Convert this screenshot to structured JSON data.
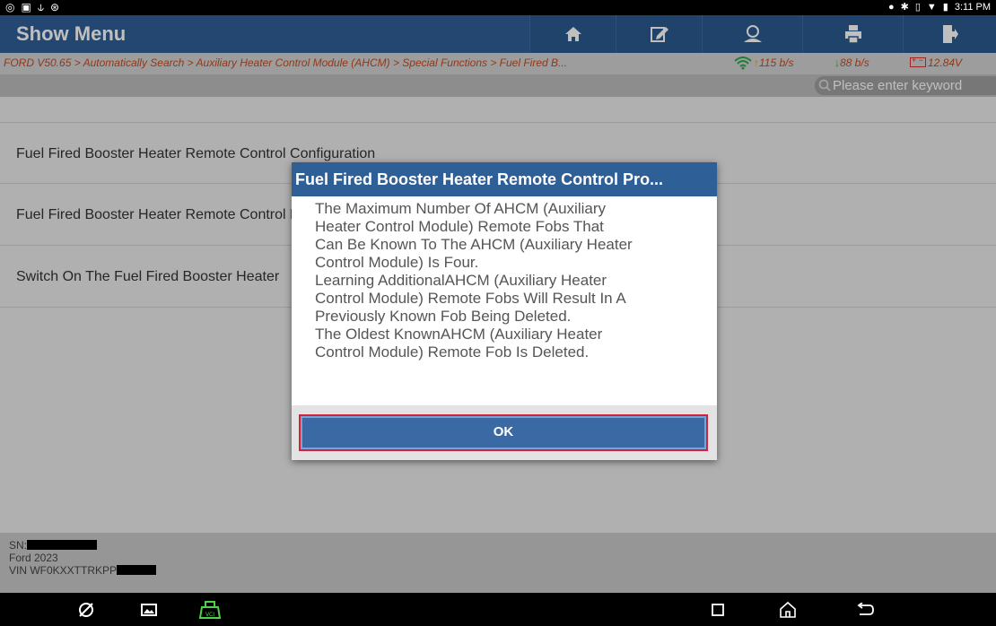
{
  "status_bar": {
    "time": "3:11 PM",
    "left_icons": [
      "chat-icon",
      "image-icon",
      "usb-icon",
      "accessibility-icon"
    ],
    "right_icons": [
      "location-icon",
      "bluetooth-icon",
      "vibrate-icon",
      "wifi-icon",
      "battery-icon"
    ]
  },
  "toolbar": {
    "title": "Show Menu",
    "buttons": [
      "home-icon",
      "edit-icon",
      "user-icon",
      "print-icon",
      "exit-icon"
    ]
  },
  "breadcrumb": {
    "path": "FORD V50.65 > Automatically Search > Auxiliary Heater Control Module (AHCM) > Special Functions > Fuel Fired B...",
    "upload_speed": "115 b/s",
    "download_speed": "88 b/s",
    "battery_voltage": "12.84V"
  },
  "search": {
    "placeholder": "Please enter keyword"
  },
  "menu_items": [
    "Fuel Fired Booster Heater Remote Control Configuration",
    "Fuel Fired Booster Heater Remote Control Programming",
    "Switch On The Fuel Fired Booster Heater"
  ],
  "footer": {
    "sn_label": "SN:",
    "vehicle": "Ford  2023",
    "vin_label": "VIN WF0KXXTTRKPP"
  },
  "dialog": {
    "title": "Fuel Fired Booster Heater Remote Control Pro...",
    "lines": [
      "The Maximum Number Of AHCM (Auxiliary",
      "Heater Control Module) Remote Fobs That",
      "Can Be Known To The AHCM (Auxiliary Heater",
      "Control Module) Is Four.",
      "Learning AdditionalAHCM (Auxiliary Heater",
      "Control Module) Remote Fobs Will Result In A",
      "Previously Known Fob Being Deleted.",
      "The Oldest KnownAHCM (Auxiliary Heater",
      "Control Module) Remote Fob Is Deleted."
    ],
    "ok_label": "OK"
  },
  "colors": {
    "toolbar": "#2f5f97",
    "breadcrumb_text": "#c54a1f",
    "ok_border": "#d3213c"
  },
  "navbar": [
    "browser-icon",
    "gallery-icon",
    "vci-icon",
    "recent-apps-icon",
    "home-nav-icon",
    "back-icon"
  ]
}
